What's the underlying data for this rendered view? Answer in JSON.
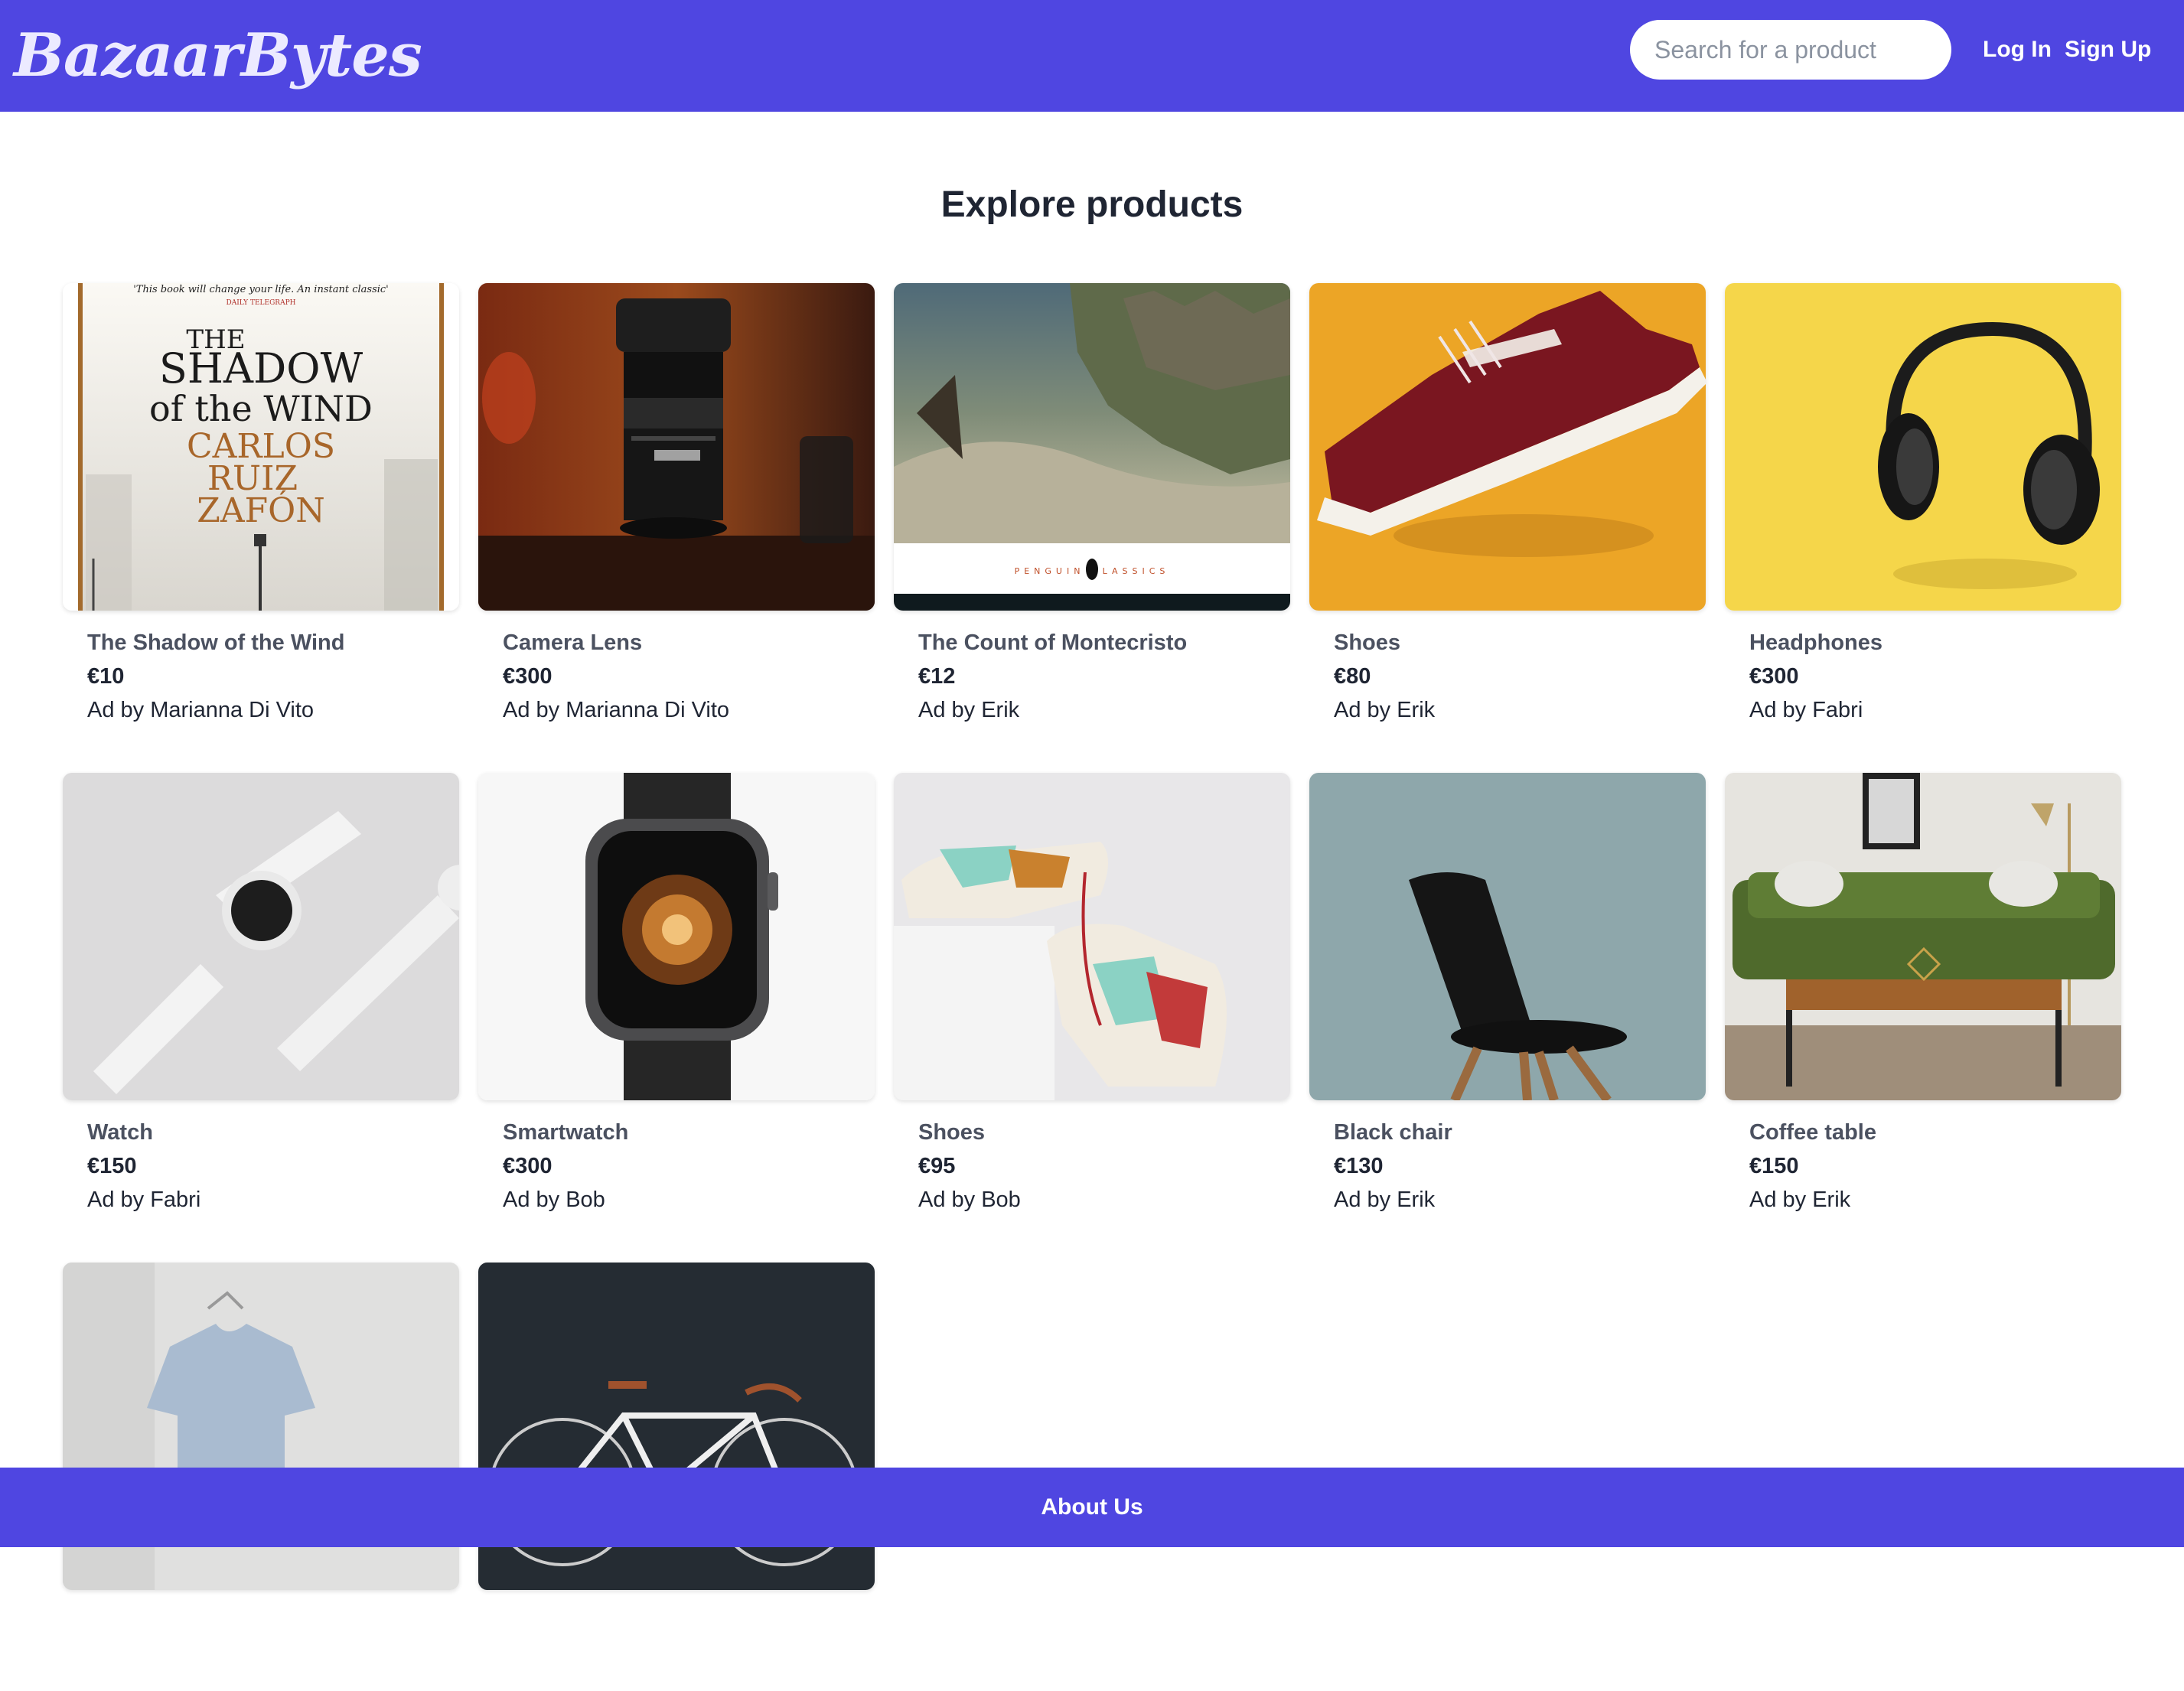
{
  "nav": {
    "logo": "BazaarBytes",
    "search_placeholder": "Search for a product",
    "login": "Log In",
    "signup": "Sign Up"
  },
  "main": {
    "heading": "Explore products",
    "products": [
      {
        "title": "The Shadow of the Wind",
        "price": "€10",
        "seller": "Ad by Marianna Di Vito",
        "image": "book-cover-image",
        "image_text": {
          "quote": "'This book will change your life. An instant classic'",
          "source": "DAILY TELEGRAPH",
          "book_title_1": "THE",
          "book_title_2": "SHADOW",
          "book_title_3": "of the WIND",
          "author_1": "CARLOS",
          "author_2": "RUIZ",
          "author_3": "ZAFÓN"
        }
      },
      {
        "title": "Camera Lens",
        "price": "€300",
        "seller": "Ad by Marianna Di Vito",
        "image": "camera-lens-image"
      },
      {
        "title": "The Count of Montecristo",
        "price": "€12",
        "seller": "Ad by Erik",
        "image": "book-painting-image",
        "image_text": {
          "publisher": "PENGUIN   CLASSICS"
        }
      },
      {
        "title": "Shoes",
        "price": "€80",
        "seller": "Ad by Erik",
        "image": "red-sneaker-image"
      },
      {
        "title": "Headphones",
        "price": "€300",
        "seller": "Ad by Fabri",
        "image": "headphones-image"
      },
      {
        "title": "Watch",
        "price": "€150",
        "seller": "Ad by Fabri",
        "image": "white-watch-image"
      },
      {
        "title": "Smartwatch",
        "price": "€300",
        "seller": "Ad by Bob",
        "image": "smartwatch-image"
      },
      {
        "title": "Shoes",
        "price": "€95",
        "seller": "Ad by Bob",
        "image": "sneakers-pair-image"
      },
      {
        "title": "Black chair",
        "price": "€130",
        "seller": "Ad by Erik",
        "image": "black-chair-image"
      },
      {
        "title": "Coffee table",
        "price": "€150",
        "seller": "Ad by Erik",
        "image": "living-room-image"
      },
      {
        "title": "",
        "price": "",
        "seller": "",
        "image": "tshirt-image"
      },
      {
        "title": "",
        "price": "",
        "seller": "",
        "image": "bicycle-image"
      }
    ]
  },
  "footer": {
    "about": "About Us"
  },
  "colors": {
    "brand": "#4f46e1",
    "text": "#1f2533",
    "muted": "#4b5160"
  }
}
